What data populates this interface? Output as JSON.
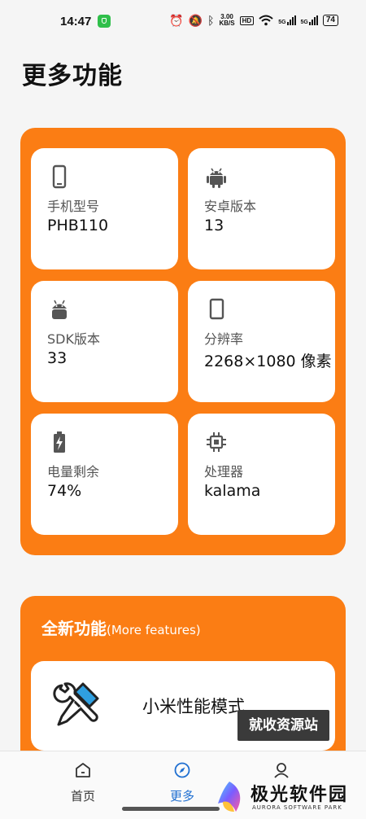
{
  "status_bar": {
    "time": "14:47",
    "net_speed_value": "3.00",
    "net_speed_unit": "KB/S",
    "hd_label": "HD",
    "signal1_label": "5G",
    "signal2_label": "5G",
    "battery": "74"
  },
  "page": {
    "title": "更多功能"
  },
  "device_info": [
    {
      "icon": "phone-icon",
      "label": "手机型号",
      "value": "PHB110"
    },
    {
      "icon": "android-icon",
      "label": "安卓版本",
      "value": "13"
    },
    {
      "icon": "android-head-icon",
      "label": "SDK版本",
      "value": "33"
    },
    {
      "icon": "screen-icon",
      "label": "分辨率",
      "value": "2268×1080 像素"
    },
    {
      "icon": "battery-charging-icon",
      "label": "电量剩余",
      "value": "74%"
    },
    {
      "icon": "chip-icon",
      "label": "处理器",
      "value": "kalama"
    }
  ],
  "features": {
    "title": "全新功能",
    "subtitle": "(More features)",
    "items": [
      {
        "icon": "tools-icon",
        "label": "小米性能模式"
      }
    ]
  },
  "watermarks": {
    "badge": "就收资源站",
    "logo_cn": "极光软件园",
    "logo_en": "AURORA SOFTWARE PARK"
  },
  "bottom_nav": [
    {
      "icon": "home-icon",
      "label": "首页",
      "active": false
    },
    {
      "icon": "compass-icon",
      "label": "更多",
      "active": true
    },
    {
      "icon": "user-icon",
      "label": "",
      "active": false
    }
  ],
  "colors": {
    "accent": "#fb7d14",
    "active_tab": "#1f6fd1",
    "background": "#f5f5f5"
  }
}
